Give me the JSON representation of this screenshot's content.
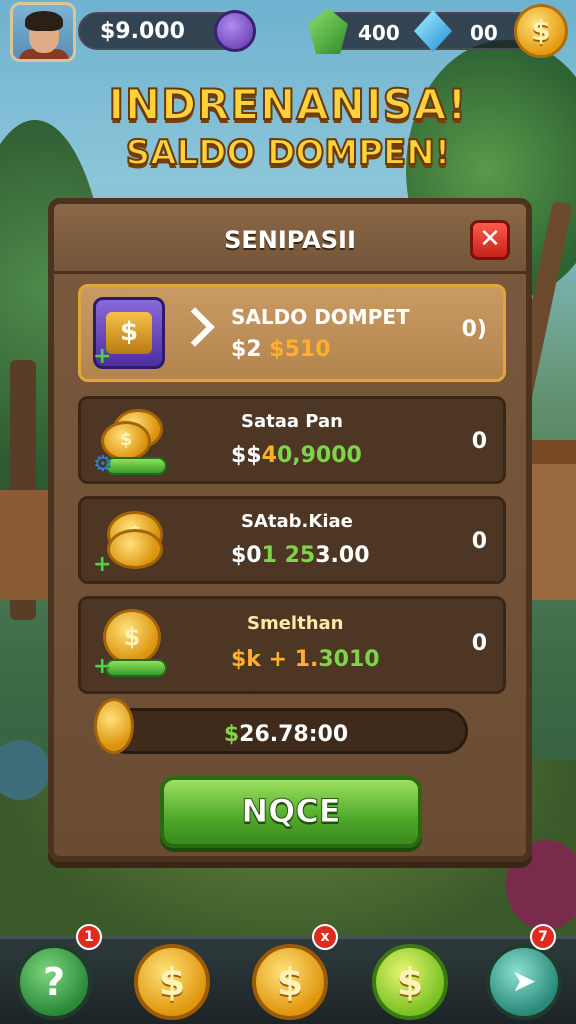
{
  "top_bar": {
    "money": "$9.000",
    "gems_green": "400",
    "gems_blue": "00",
    "coin_symbol": "$"
  },
  "title": {
    "line1": "INDRENANISA!",
    "line2": "SALDO DOMPEN!"
  },
  "panel": {
    "title": "SENIPASII",
    "close_label": "✕",
    "rows": [
      {
        "name": "SALDO DOMPET",
        "amount_prefix": "$2 ",
        "amount_highlight": "",
        "amount_rest": "$510",
        "count": "0)",
        "icon_symbol": "$"
      },
      {
        "name": "Sataa Pan",
        "amount_prefix": "$$",
        "amount_highlight": "4",
        "amount_rest": "0,9000",
        "count": "0",
        "icon_symbol": "$"
      },
      {
        "name": "SAtab.Kiae",
        "amount_prefix": "$0",
        "amount_highlight": "1 25",
        "amount_rest": "3.00",
        "count": "0",
        "icon_symbol": "$"
      },
      {
        "name": "Smelthan",
        "amount_prefix": "$k ",
        "amount_highlight": "+ 1.",
        "amount_rest": "3010",
        "count": "0",
        "icon_symbol": "$"
      }
    ],
    "total": {
      "sign": "$",
      "value": "26.78:00"
    },
    "ok_button": "NQCE"
  },
  "bottom_nav": {
    "help_symbol": "?",
    "coin_symbol": "$",
    "send_symbol": "➤",
    "badges": [
      "1",
      "x",
      "7"
    ]
  },
  "colors": {
    "accent_gold": "#ffd23a",
    "panel_brown": "#6a4c33",
    "ok_green": "#4fa82a",
    "close_red": "#c4221a"
  }
}
